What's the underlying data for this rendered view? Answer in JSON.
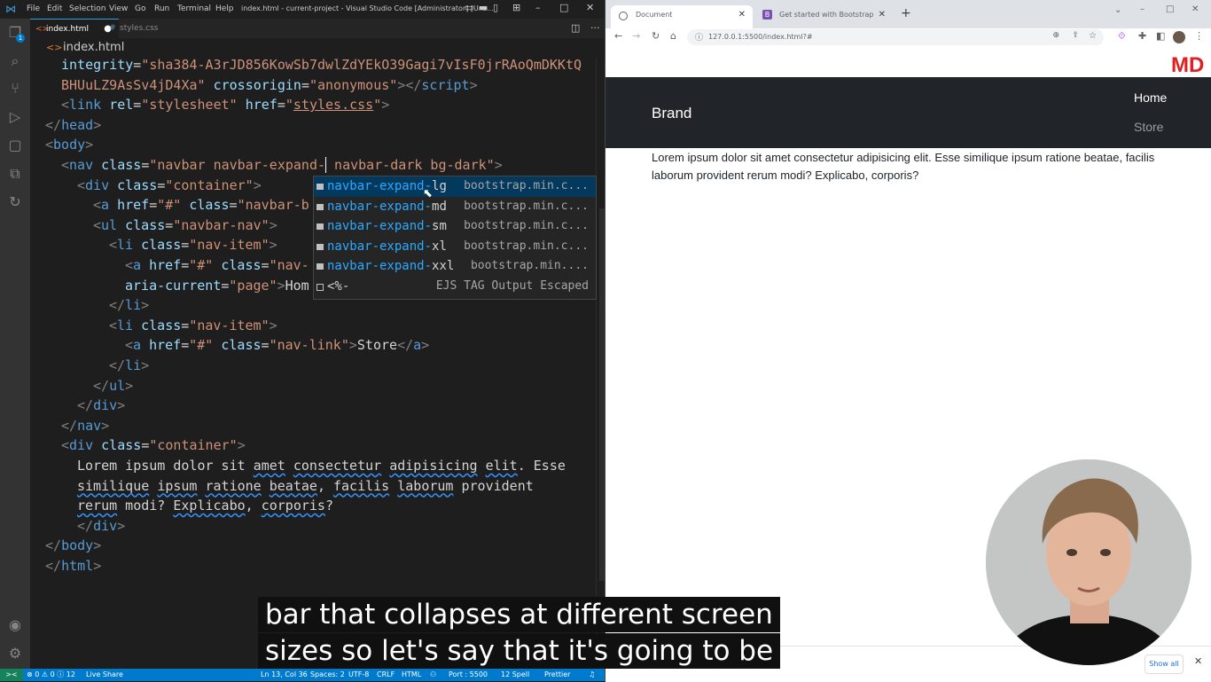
{
  "vscode": {
    "menu": [
      "File",
      "Edit",
      "Selection",
      "View",
      "Go",
      "Run",
      "Terminal",
      "Help"
    ],
    "window_title": "index.html - current-project - Visual Studio Code [Administrator] [Uns...",
    "tabs": [
      {
        "label": "index.html",
        "modified": true,
        "active": true
      },
      {
        "label": "styles.css",
        "modified": false,
        "active": false
      }
    ],
    "breadcrumb": "index.html",
    "activity_badge": "1",
    "suggestions": [
      {
        "match": "navbar-expand-",
        "rest": "lg",
        "detail": "bootstrap.min.c..."
      },
      {
        "match": "navbar-expand-",
        "rest": "md",
        "detail": "bootstrap.min.c..."
      },
      {
        "match": "navbar-expand-",
        "rest": "sm",
        "detail": "bootstrap.min.c..."
      },
      {
        "match": "navbar-expand-",
        "rest": "xl",
        "detail": "bootstrap.min.c..."
      },
      {
        "match": "navbar-expand-",
        "rest": "xxl",
        "detail": "bootstrap.min...."
      },
      {
        "match": "",
        "rest": "<%-",
        "detail": "EJS TAG Output Escaped"
      }
    ],
    "status": {
      "remote": "><",
      "problems": "⊗ 0 ⚠ 0 ⓘ 12",
      "liveshare": "Live Share",
      "position": "Ln 13, Col 36",
      "spaces": "Spaces: 2",
      "encoding": "UTF-8",
      "eol": "CRLF",
      "language": "HTML",
      "port": "Port : 5500",
      "spell": "12 Spell",
      "prettier": "Prettier"
    }
  },
  "browser": {
    "tabs": [
      {
        "title": "Document"
      },
      {
        "title": "Get started with Bootstrap · Boo..."
      }
    ],
    "url": "127.0.0.1:5500/index.html?#",
    "logo": "MD",
    "brand": "Brand",
    "nav": [
      "Home",
      "Store"
    ],
    "lorem": "Lorem ipsum dolor sit amet consectetur adipisicing elit. Esse similique ipsum ratione beatae, facilis laborum provident rerum modi? Explicabo, corporis?",
    "show_all": "Show all"
  },
  "captions": [
    "bar that collapses at different screen",
    "sizes so let's say that it's going to be"
  ]
}
